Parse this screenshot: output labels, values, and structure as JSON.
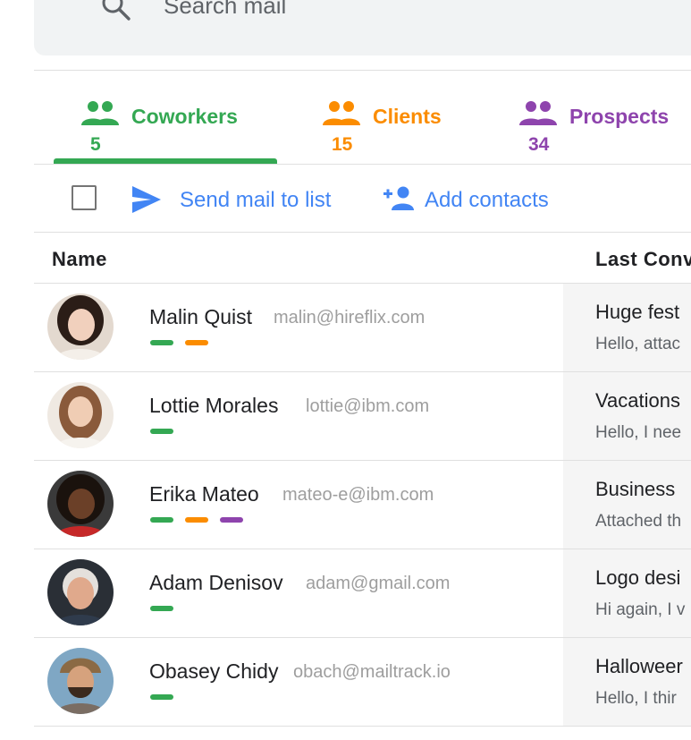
{
  "search": {
    "placeholder": "Search mail",
    "icon": "search-icon"
  },
  "tabs": [
    {
      "label": "Coworkers",
      "count": "5",
      "color": "#34a853",
      "icon": "people-icon",
      "selected": true
    },
    {
      "label": "Clients",
      "count": "15",
      "color": "#fb8c00",
      "icon": "people-icon",
      "selected": false
    },
    {
      "label": "Prospects",
      "count": "34",
      "color": "#8e44ad",
      "icon": "people-icon",
      "selected": false
    }
  ],
  "toolbar": {
    "send_label": "Send mail to list",
    "add_label": "Add contacts",
    "accent": "#4285f4"
  },
  "table": {
    "columns": [
      "Name",
      "Last Conv"
    ],
    "rows": [
      {
        "name": "Malin Quist",
        "email": "malin@hireflix.com",
        "tags": [
          "coworker",
          "client"
        ],
        "subject": "Huge fest",
        "snippet": "Hello, attac"
      },
      {
        "name": "Lottie Morales",
        "email": "lottie@ibm.com",
        "tags": [
          "coworker"
        ],
        "subject": "Vacations",
        "snippet": "Hello, I nee"
      },
      {
        "name": "Erika Mateo",
        "email": "mateo-e@ibm.com",
        "tags": [
          "coworker",
          "client",
          "prospect"
        ],
        "subject": "Business",
        "snippet": "Attached th"
      },
      {
        "name": "Adam Denisov",
        "email": "adam@gmail.com",
        "tags": [
          "coworker"
        ],
        "subject": "Logo desi",
        "snippet": "Hi again, I v"
      },
      {
        "name": "Obasey Chidy",
        "email": "obach@mailtrack.io",
        "tags": [
          "coworker"
        ],
        "subject": "Halloweer",
        "snippet": "Hello, I thir"
      }
    ]
  },
  "tag_colors": {
    "coworker": "#34a853",
    "client": "#fb8c00",
    "prospect": "#8e44ad"
  }
}
